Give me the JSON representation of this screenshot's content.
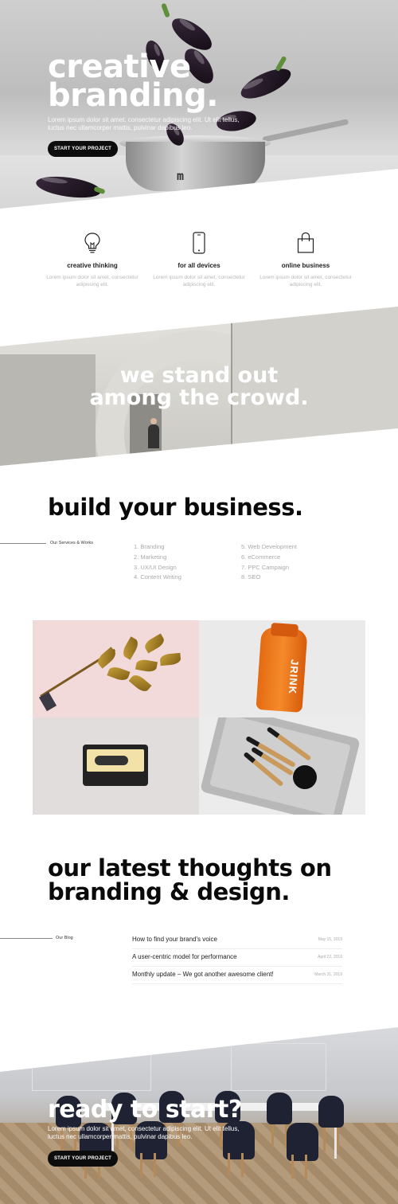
{
  "hero": {
    "title_line1": "creative",
    "title_line2": "branding.",
    "text": "Lorem ipsum dolor sit amet, consectetur adipiscing elit. Ut elit tellus, luctus nec ullamcorper mattis, pulvinar dapibus leo.",
    "button": "START YOUR PROJECT",
    "pan_logo": "m"
  },
  "features": [
    {
      "icon": "lightbulb-icon",
      "title": "creative thinking",
      "text": "Lorem ipsum dolor sit amet, consectetur adipiscing elit."
    },
    {
      "icon": "smartphone-icon",
      "title": "for all devices",
      "text": "Lorem ipsum dolor sit amet, consectetur adipiscing elit."
    },
    {
      "icon": "shopping-bag-icon",
      "title": "online business",
      "text": "Lorem ipsum dolor sit amet, consectetur adipiscing elit."
    }
  ],
  "standout": {
    "line1": "we stand out",
    "line2": "among the crowd."
  },
  "business": {
    "title": "build your business.",
    "side_label": "Our Services & Works",
    "services_left": [
      "1. Branding",
      "2. Marketing",
      "3. UX/UI Design",
      "4. Content Writing"
    ],
    "services_right": [
      "5. Web Development",
      "6. eCommerce",
      "7. PPC Campaign",
      "8. SEO"
    ]
  },
  "gallery": {
    "bottle_label": "JRINK"
  },
  "blog": {
    "title_line1": "our latest thoughts on",
    "title_line2": "branding & design.",
    "side_label": "Our Blog",
    "posts": [
      {
        "title": "How to find your brand's voice",
        "date": "May 15, 2019"
      },
      {
        "title": "A user-centric model for performance",
        "date": "April 22, 2019"
      },
      {
        "title": "Monthly update – We got another awesome client!",
        "date": "March 31, 2019"
      }
    ]
  },
  "cta": {
    "title": "ready to start?",
    "text": "Lorem ipsum dolor sit amet, consectetur adipiscing elit. Ut elit tellus, luctus nec ullamcorper mattis, pulvinar dapibus leo.",
    "button": "START YOUR PROJECT"
  },
  "colors": {
    "text": "#111111",
    "muted": "#b8b8b8",
    "button_bg": "#0d0d0d",
    "button_text": "#ffffff"
  }
}
